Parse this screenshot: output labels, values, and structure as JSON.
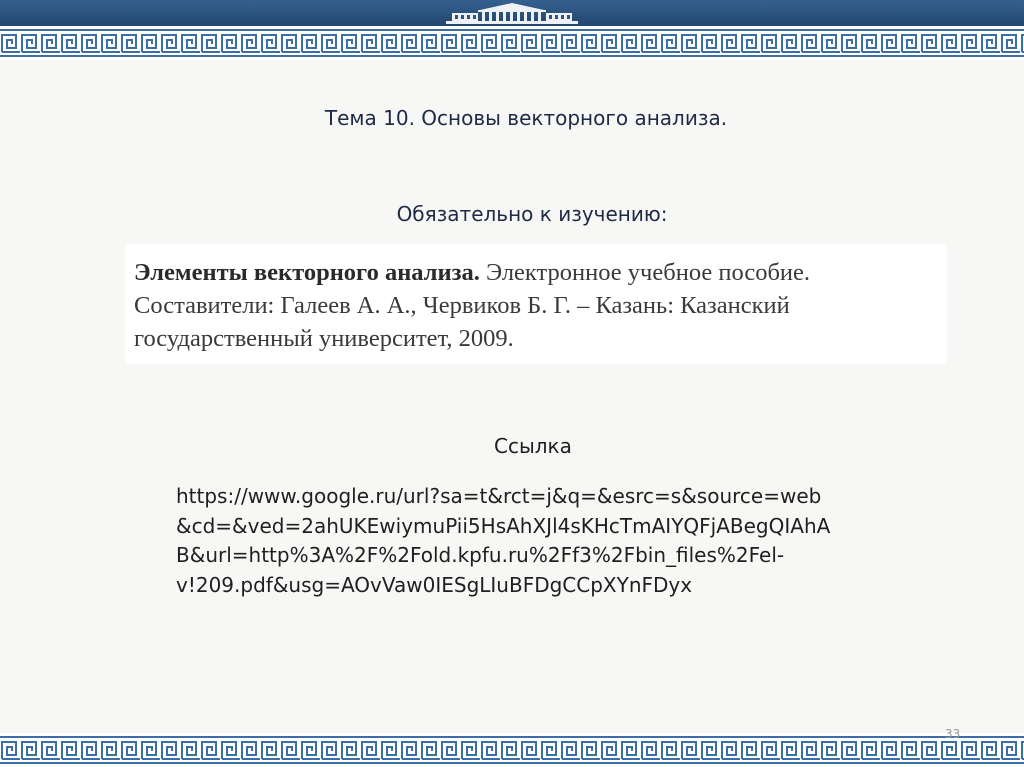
{
  "slide": {
    "title": "Тема 10. Основы векторного анализа.",
    "subtitle": "Обязательно к изучению:",
    "book": {
      "title_bold": "Элементы векторного анализа.",
      "line1_rest": "Электронное учебное пособие.",
      "line2": "Составители: Галеев А. А., Червиков Б. Г. – Казань: Казанский",
      "line3": "государственный университет, 2009."
    },
    "link_label": "Ссылка",
    "url_lines": [
      "https://www.google.ru/url?sa=t&rct=j&q=&esrc=s&source=web",
      "&cd=&ved=2ahUKEwiymuPii5HsAhXJl4sKHcTmAIYQFjABegQIAhA",
      "B&url=http%3A%2F%2Fold.kpfu.ru%2Ff3%2Fbin_files%2Fel-",
      "v!209.pdf&usg=AOvVaw0IESgLIuBFDgCCpXYnFDyx"
    ],
    "page_number": "33"
  },
  "theme": {
    "header_blue": "#2b5384",
    "pattern_blue": "#3b6ea5",
    "text_dark": "#1f2a44"
  },
  "icons": {
    "header": "university-building-icon",
    "border": "greek-key-border"
  }
}
